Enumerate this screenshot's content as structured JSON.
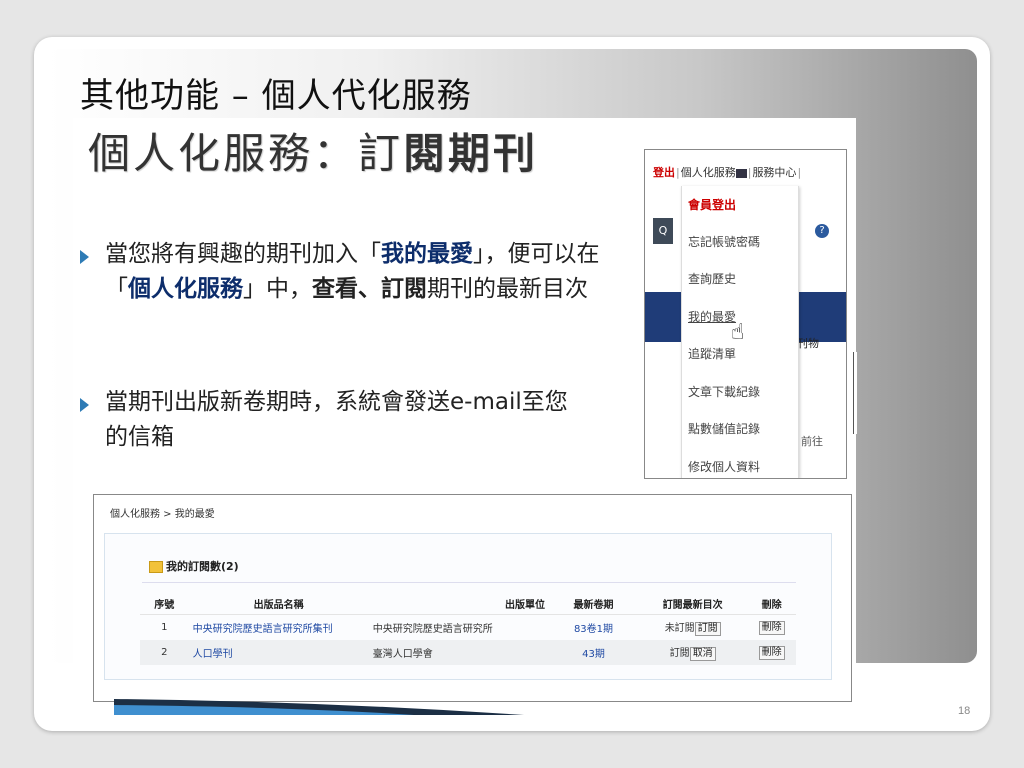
{
  "slide": {
    "title": "其他功能 – 個人代化服務",
    "heading_normal": "個人化服務：訂",
    "heading_bold": "閱期刊",
    "page_number": "18"
  },
  "bullets": [
    {
      "p1": "當您將有興趣的期刊加入「",
      "h1": "我的最愛",
      "p2": "」，便可以在「",
      "h2": "個人化服務",
      "p3": "」中，",
      "b1": "查看、訂閱",
      "p4": "期刊的最新目次"
    },
    {
      "p1": "當期刊出版新卷期時，系統會發送",
      "s1": "e-mail",
      "p2": "至您的信箱"
    }
  ],
  "menu": {
    "logout": "登出",
    "top_item1": "個人化服務",
    "top_item2": "服務中心",
    "search_icon_glyph": "Q",
    "help_glyph": "?",
    "right_text": "刊物",
    "goto": "前往",
    "items": [
      {
        "label": "會員登出"
      },
      {
        "label": "忘記帳號密碼"
      },
      {
        "label": "查詢歷史"
      },
      {
        "label": "我的最愛"
      },
      {
        "label": "追蹤清單"
      },
      {
        "label": "文章下載紀錄"
      },
      {
        "label": "點數儲值記錄"
      },
      {
        "label": "修改個人資料"
      }
    ]
  },
  "subscriptions": {
    "breadcrumb": "個人化服務 > 我的最愛",
    "title": "我的訂閱數(2)",
    "columns": [
      "序號",
      "出版品名稱",
      "出版單位",
      "最新卷期",
      "訂閱最新目次",
      "刪除"
    ],
    "rows": [
      {
        "no": "1",
        "name": "中央研究院歷史語言研究所集刊",
        "publisher": "中央研究院歷史語言研究所",
        "issue": "83卷1期",
        "status": "未訂閱",
        "action": "訂閱",
        "delete": "刪除"
      },
      {
        "no": "2",
        "name": "人口學刊",
        "publisher": "臺灣人口學會",
        "issue": "43期",
        "status": "訂閱",
        "action": "取消",
        "delete": "刪除"
      }
    ]
  },
  "colors": {
    "accent_blue": "#2e7bb5",
    "highlight_navy": "#0d2d6b",
    "menu_red": "#cc0000",
    "menu_bar_blue": "#1f3c78"
  }
}
